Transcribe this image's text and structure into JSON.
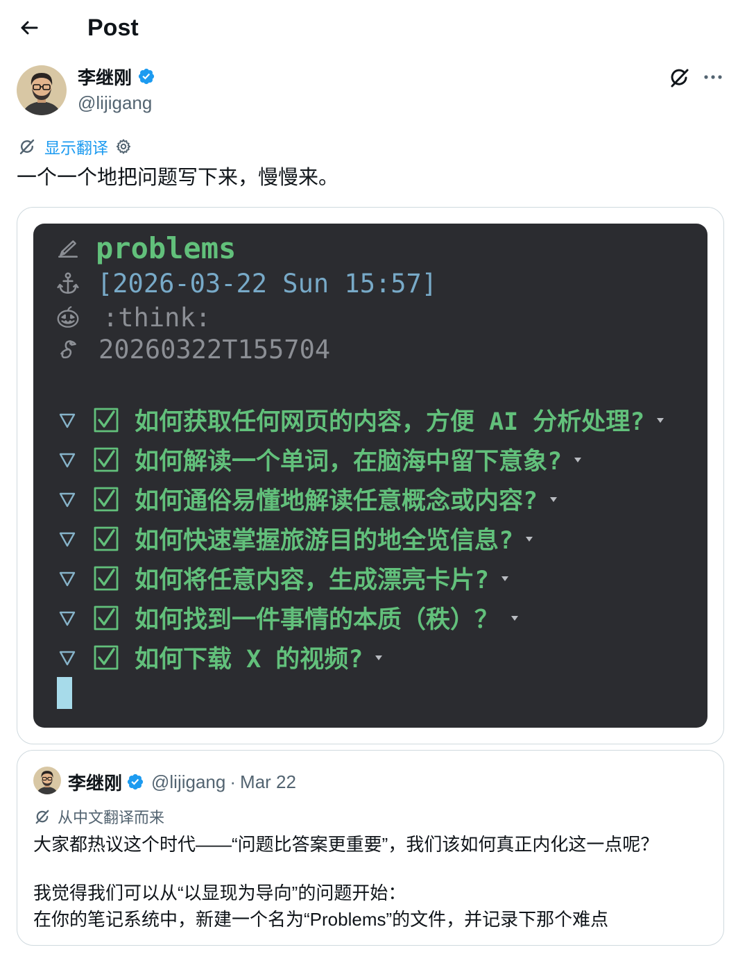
{
  "header": {
    "title": "Post"
  },
  "author": {
    "name": "李继刚",
    "handle": "@lijigang",
    "verified": true
  },
  "translate_toggle": {
    "label": "显示翻译"
  },
  "tweet": {
    "text": "一个一个地把问题写下来，慢慢来。"
  },
  "terminal": {
    "title": "problems",
    "timestamp": "[2026-03-22 Sun 15:57]",
    "tag": ":think:",
    "identifier": "20260322T155704",
    "items": [
      {
        "text": "如何获取任何网页的内容，方便 AI 分析处理?",
        "checked": true
      },
      {
        "text": "如何解读一个单词，在脑海中留下意象?",
        "checked": true
      },
      {
        "text": "如何通俗易懂地解读任意概念或内容?",
        "checked": true
      },
      {
        "text": "如何快速掌握旅游目的地全览信息?",
        "checked": true
      },
      {
        "text": "如何将任意内容，生成漂亮卡片?",
        "checked": true
      },
      {
        "text": "如何找到一件事情的本质（秩）？",
        "checked": true
      },
      {
        "text": "如何下载 X 的视频?",
        "checked": true
      }
    ]
  },
  "quote": {
    "name": "李继刚",
    "handle": "@lijigang",
    "separator": "·",
    "date": "Mar 22",
    "verified": true,
    "translated_label": "从中文翻译而来",
    "body": [
      {
        "lines": [
          "大家都热议这个时代——“问题比答案更重要”，我们该如何真正内化这一点呢？"
        ]
      },
      {
        "lines": [
          "我觉得我们可以从“以显现为导向”的问题开始：",
          "在你的笔记系统中，新建一个名为“Problems”的文件，并记录下那个难点"
        ]
      }
    ]
  },
  "icons": {
    "back": "arrow-left-icon",
    "verified": "verified-badge-icon",
    "grok": "grok-icon",
    "more": "more-icon",
    "translate": "grok-translate-icon",
    "settings": "gear-icon",
    "title_marker": "pen-icon",
    "timestamp_marker": "anchor-icon",
    "tag_marker": "pumpkin-icon",
    "id_marker": "seahorse-icon",
    "fold": "fold-triangle-icon",
    "checkbox": "checkbox-checked-icon",
    "collapsed": "collapsed-marker-icon"
  },
  "colors": {
    "text": "#0f1419",
    "secondary": "#536471",
    "link": "#1d9bf0",
    "verified": "#1d9bf0",
    "border": "#cfd9de",
    "terminal_bg": "#2b2c30",
    "terminal_green": "#62c07b",
    "terminal_timestamp": "#78aac8",
    "terminal_muted": "#8c8f95",
    "cursor": "#a7dbea",
    "fold_marker": "#86b3c9",
    "collapsed_marker": "#b9bcc1"
  }
}
